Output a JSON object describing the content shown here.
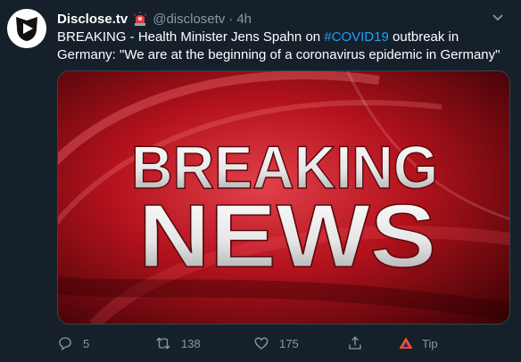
{
  "tweet": {
    "display_name": "Disclose.tv",
    "handle": "@disclosetv",
    "separator": "·",
    "time": "4h",
    "text_prefix": "BREAKING - Health Minister Jens Spahn on ",
    "hashtag": "#COVID19",
    "text_suffix": " outbreak in Germany: \"We are at the beginning of a coronavirus epidemic in Germany\""
  },
  "media": {
    "line1": "BREAKING",
    "line2": "NEWS"
  },
  "actions": {
    "reply_count": "5",
    "retweet_count": "138",
    "like_count": "175",
    "tip_label": "Tip"
  },
  "colors": {
    "background": "#15202b",
    "muted": "#8899a6",
    "link": "#1da1f2",
    "breaking_red": "#b3121c"
  },
  "icons": [
    "avatar-logo-icon",
    "siren-emoji-icon",
    "chevron-down-icon",
    "reply-icon",
    "retweet-icon",
    "like-icon",
    "share-icon",
    "tip-icon"
  ]
}
